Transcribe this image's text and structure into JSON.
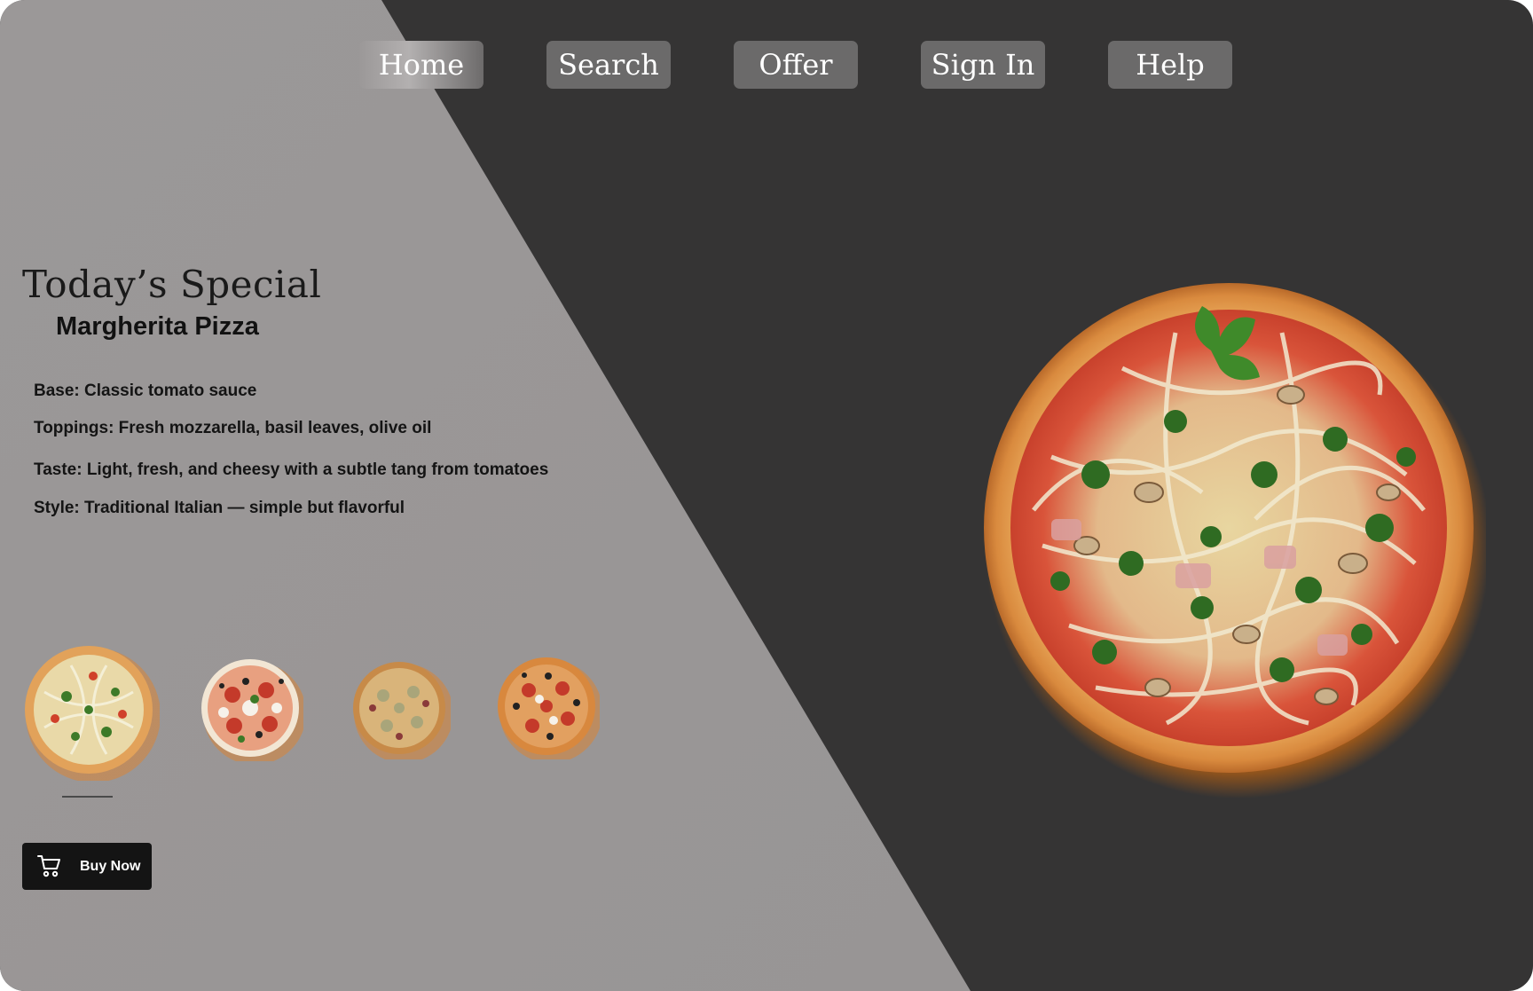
{
  "nav": {
    "items": [
      {
        "label": "Home",
        "active": true
      },
      {
        "label": "Search",
        "active": false
      },
      {
        "label": "Offer",
        "active": false
      },
      {
        "label": "Sign In",
        "active": false
      },
      {
        "label": "Help",
        "active": false
      }
    ]
  },
  "special": {
    "heading": "Today’s Special",
    "name": "Margherita Pizza",
    "details": [
      "Base: Classic tomato sauce",
      "Toppings: Fresh mozzarella, basil leaves, olive oil",
      "Taste: Light, fresh, and cheesy with a subtle tang from tomatoes",
      "Style: Traditional Italian — simple but flavorful"
    ]
  },
  "carousel": {
    "selected_index": 0,
    "items": [
      "pizza-thumbnail-1",
      "pizza-thumbnail-2",
      "pizza-thumbnail-3",
      "pizza-thumbnail-4"
    ]
  },
  "buy": {
    "label": "Buy Now",
    "icon": "cart-icon"
  },
  "colors": {
    "left_panel": "#9a9797",
    "right_panel": "#353434",
    "nav_button": "#6b6a6a",
    "buy_button": "#141414",
    "glow": "#ff7a00"
  }
}
